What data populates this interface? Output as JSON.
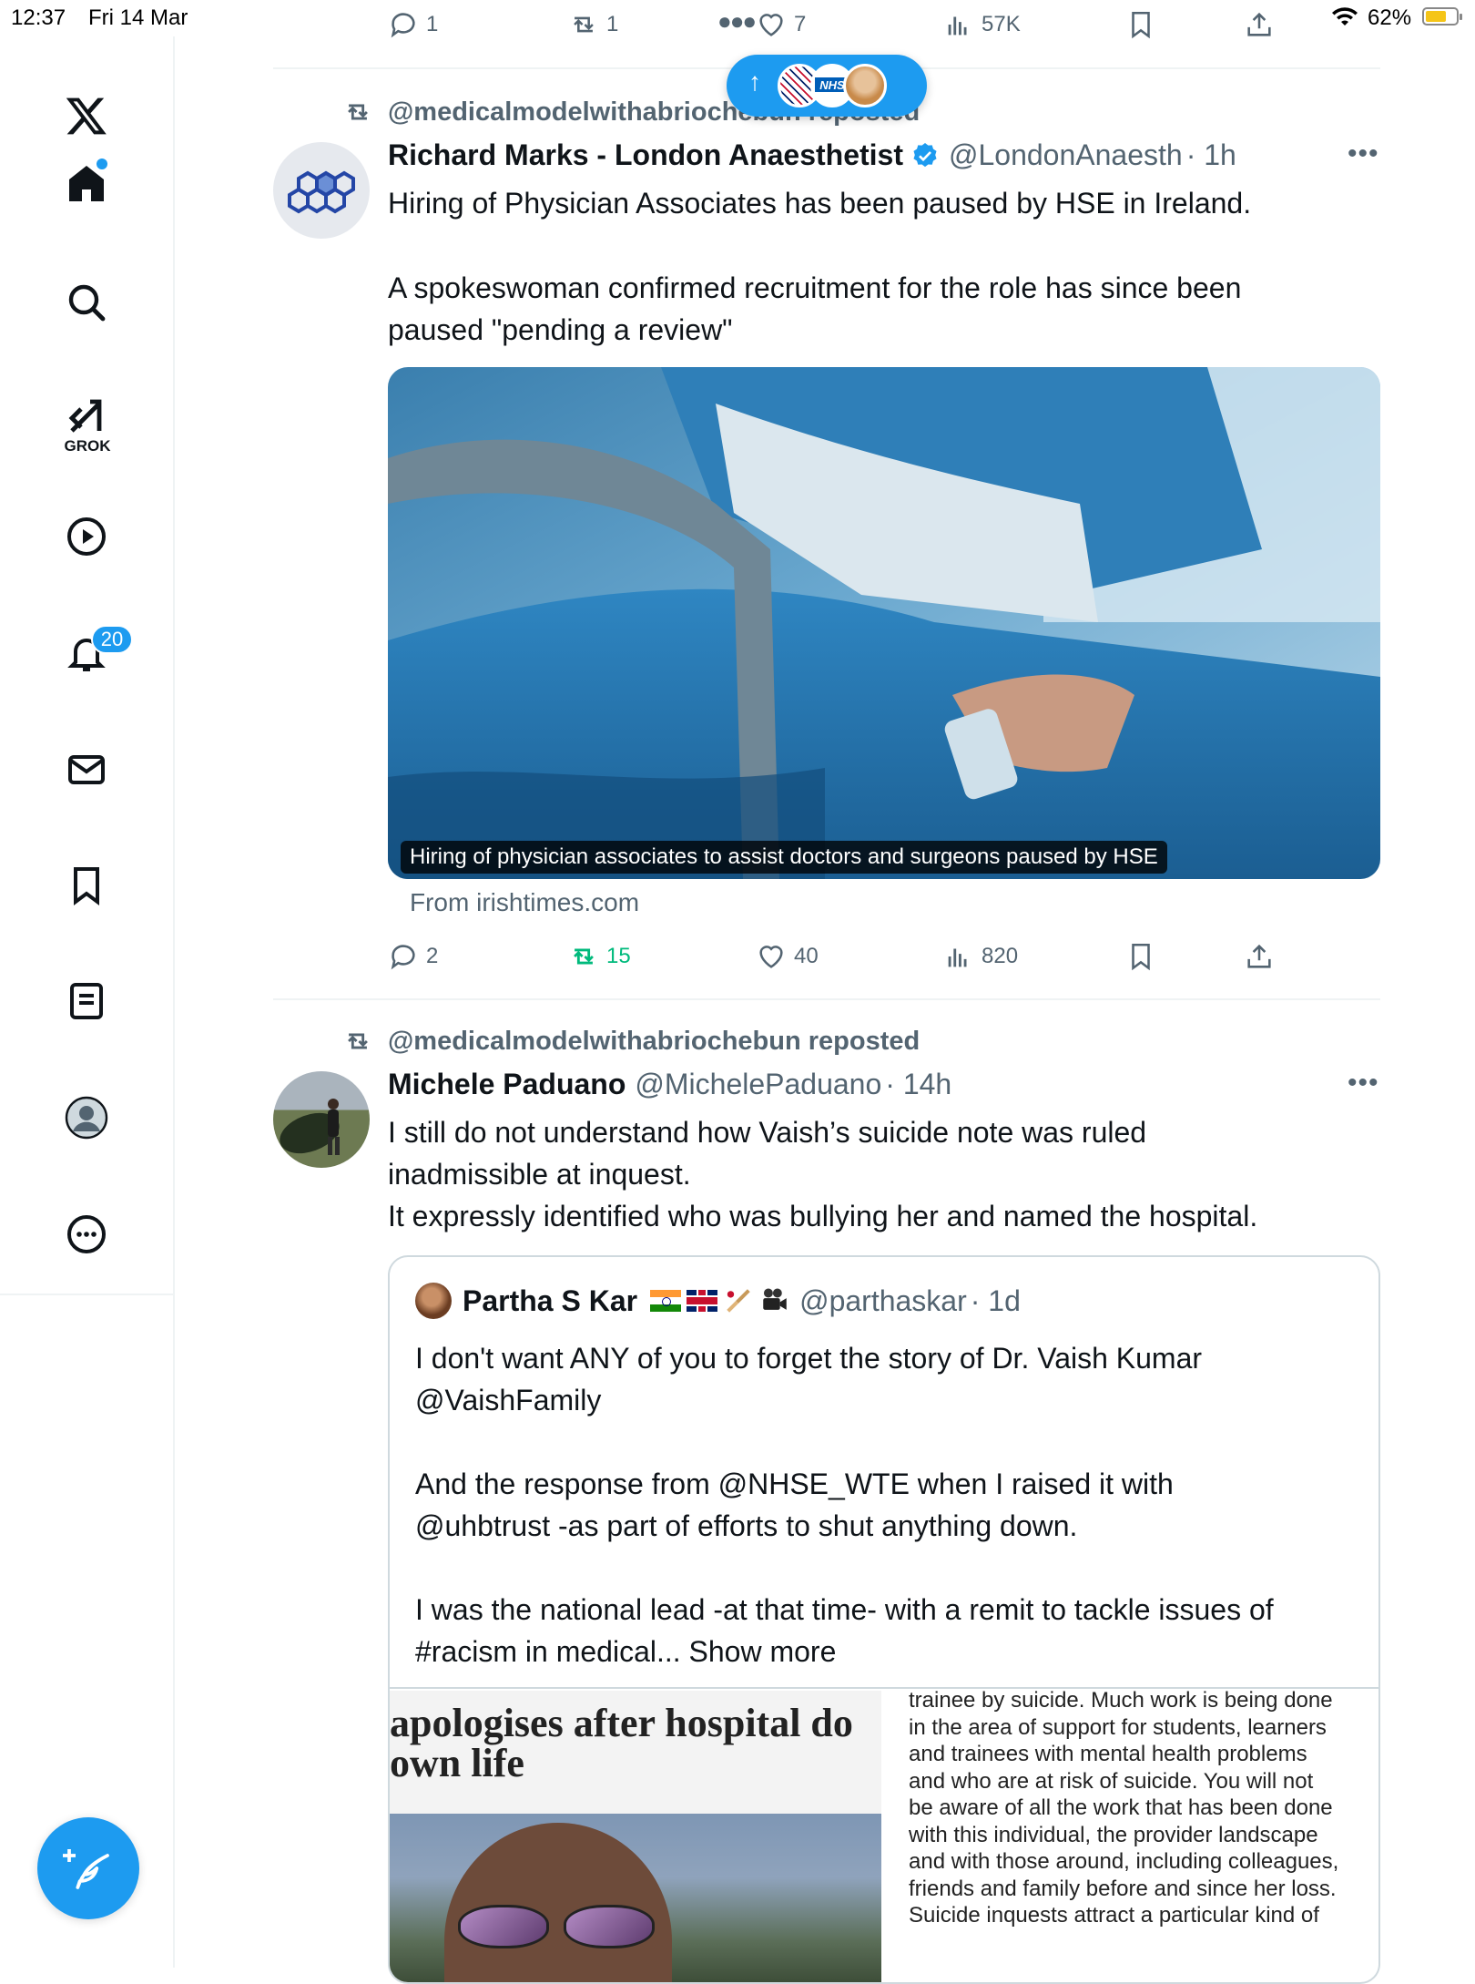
{
  "status_bar": {
    "time": "12:37",
    "date": "Fri 14 Mar",
    "battery": "62%",
    "battery_level": 0.62
  },
  "sidebar": {
    "items": [
      "home",
      "search",
      "grok",
      "video",
      "notifications",
      "messages",
      "bookmarks",
      "lists",
      "profile",
      "more"
    ],
    "grok_label": "GROK",
    "notifications_badge": "20"
  },
  "top_actions": {
    "replies": "1",
    "reposts": "1",
    "likes": "7",
    "views": "57K"
  },
  "tweet1": {
    "repost_label": "@medicalmodelwithabriochebun reposted",
    "author_name": "Richard Marks - London Anaesthetist",
    "handle": "@LondonAnaesth",
    "time": "· 1h",
    "text_line1": "Hiring of Physician Associates has been paused by HSE in Ireland.",
    "text_line2": "A spokeswoman confirmed recruitment for the role has since been",
    "text_line3": "paused \"pending a review\"",
    "card_caption": "Hiring of physician associates to assist doctors and surgeons paused by HSE",
    "card_source": "From irishtimes.com",
    "replies": "2",
    "reposts": "15",
    "likes": "40",
    "views": "820"
  },
  "tweet2": {
    "repost_label": "@medicalmodelwithabriochebun reposted",
    "author_name": "Michele Paduano",
    "handle": "@MichelePaduano",
    "time": "· 14h",
    "text_line1": "I still do not understand how Vaish’s suicide note was ruled",
    "text_line2": "inadmissible at inquest.",
    "text_line3": "It expressly identified who was bullying her and named the hospital.",
    "quote": {
      "author_name": "Partha S Kar",
      "handle": "@parthaskar",
      "time": "· 1d",
      "line1": "I don't want ANY of you to forget the story of Dr. Vaish Kumar",
      "line2": "@VaishFamily",
      "line3": "And the response from @NHSE_WTE when I raised it with",
      "line4": "@uhbtrust -as part of efforts to shut anything down.",
      "line5": "I was the national lead -at that time- with a remit to tackle issues of",
      "line6": "#racism in medical... Show more",
      "headline1": "apologises after hospital do",
      "headline2": "own life",
      "letter": [
        "trainee by suicide. Much work is being done",
        "in the area of support for students, learners",
        "and trainees with mental health problems",
        "and who are at risk of suicide. You will not",
        "be aware of all the work that has been done",
        "with this individual, the provider landscape",
        "and with those around, including colleagues,",
        "friends and family before and since her loss.",
        "Suicide inquests attract a particular kind of"
      ]
    }
  },
  "colors": {
    "accent": "#1d9bf0",
    "repost_green": "#00ba7c",
    "muted": "#536471"
  }
}
